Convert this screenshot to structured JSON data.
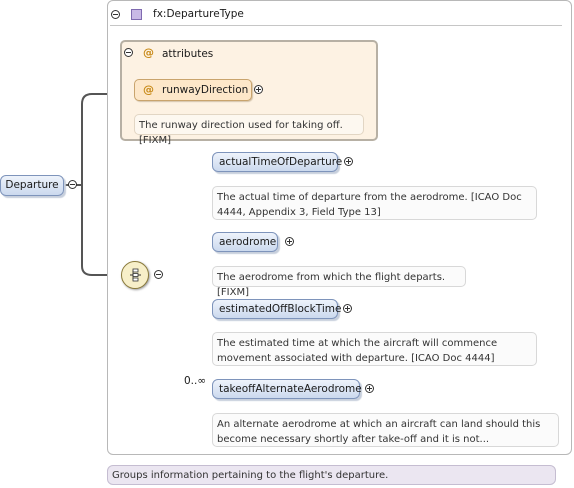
{
  "type_name": "fx:DepartureType",
  "attributes_label": "attributes",
  "attribute": {
    "name": "runwayDirection",
    "description": "The runway direction used for taking off. [FIXM]"
  },
  "root_element": "Departure",
  "elements": [
    {
      "name": "actualTimeOfDeparture",
      "description_lines": [
        "The actual time of departure from the aerodrome. [ICAO Doc",
        "4444, Appendix 3, Field Type 13]"
      ]
    },
    {
      "name": "aerodrome",
      "description_lines": [
        "The aerodrome from which the flight departs. [FIXM]"
      ]
    },
    {
      "name": "estimatedOffBlockTime",
      "description_lines": [
        "The estimated time at which the aircraft will commence",
        "movement associated with departure. [ICAO Doc 4444]"
      ]
    },
    {
      "name": "takeoffAlternateAerodrome",
      "multiplicity": "0..∞",
      "description_lines": [
        "An alternate aerodrome at which an aircraft can land should this",
        "become necessary shortly after take-off and it is not..."
      ]
    }
  ],
  "root_description": "Groups information pertaining to the flight's departure.",
  "colors": {
    "element_pill": "#cbd9ee",
    "attribute_panel": "#fdf2e3",
    "attribute_pill": "#fde7c9",
    "type_icon": "#c9b9e6",
    "footer_note": "#ebe6f1"
  }
}
